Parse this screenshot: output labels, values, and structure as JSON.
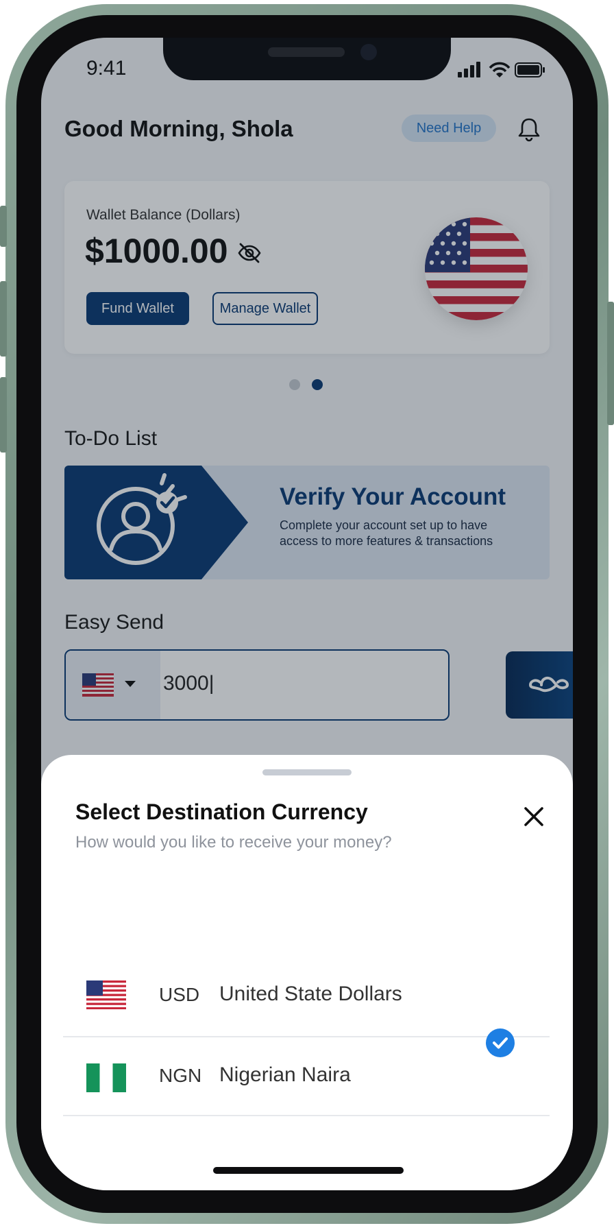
{
  "status_bar": {
    "time": "9:41"
  },
  "header": {
    "greeting": "Good Morning, Shola",
    "help_label": "Need Help"
  },
  "wallet": {
    "label": "Wallet Balance (Dollars)",
    "amount": "$1000.00",
    "fund_label": "Fund Wallet",
    "manage_label": "Manage Wallet",
    "carousel_active_index": 2,
    "carousel_count": 2
  },
  "todo": {
    "title": "To-Do List",
    "banner_title": "Verify Your Account",
    "banner_subtitle": "Complete your account set up to have access to more features & transactions"
  },
  "easy_send": {
    "title": "Easy Send",
    "amount_value": "3000|"
  },
  "sheet": {
    "title": "Select Destination Currency",
    "subtitle": "How would you like to receive your money?",
    "currencies": [
      {
        "code": "USD",
        "name": "United State Dollars",
        "selected": false
      },
      {
        "code": "NGN",
        "name": "Nigerian Naira",
        "selected": true
      }
    ]
  },
  "colors": {
    "primary": "#0b3a74",
    "accent_blue": "#1e7fe3",
    "help_bg": "#d3e4f4",
    "frame": "#7d9689"
  },
  "icons": [
    "bell-icon",
    "eye-off-icon",
    "chevron-down-icon",
    "swap-icon",
    "close-icon",
    "check-icon",
    "user-verify-icon"
  ]
}
